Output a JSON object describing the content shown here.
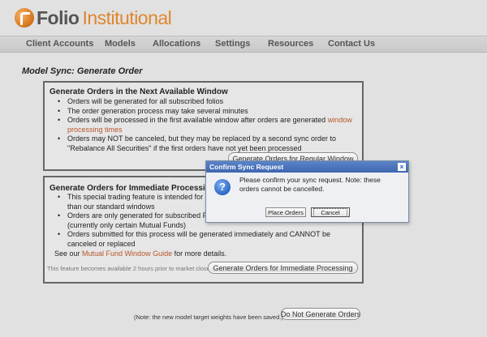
{
  "brand": {
    "name_bold": "Folio",
    "name_light": "Institutional"
  },
  "nav": {
    "items": [
      {
        "label": "Client Accounts"
      },
      {
        "label": "Models"
      },
      {
        "label": "Allocations"
      },
      {
        "label": "Settings"
      },
      {
        "label": "Resources"
      },
      {
        "label": "Contact Us"
      }
    ]
  },
  "page": {
    "title": "Model Sync: Generate Order"
  },
  "panel_regular": {
    "title": "Generate Orders in the Next Available Window",
    "bullets": [
      "Orders will be generated for all subscribed folios",
      "The order generation process may take several minutes",
      "Orders will be processed in the first available window after orders are generated",
      "Orders may NOT be canceled, but they may be replaced by a second sync order to \"Rebalance All Securities\" if the first orders have not yet been processed"
    ],
    "window_link": "window processing times",
    "button": "Generate Orders for Regular Window"
  },
  "panel_immediate": {
    "title": "Generate Orders for Immediate Processing",
    "bullets": [
      "This special trading feature is intended for mu",
      "than our standard windows",
      "Orders are only generated for subscribed Foli",
      "(currently only certain Mutual Funds)",
      "Orders submitted for this process will be generated immediately and CANNOT be canceled or replaced"
    ],
    "guide_prefix": "See our ",
    "guide_link": "Mutual Fund Window Guide",
    "guide_suffix": " for more details.",
    "availability_note": "This feature becomes available 2 hours prior to market close",
    "button": "Generate Orders for Immediate Processing"
  },
  "footer": {
    "note": "(Note: the new model target weights have been saved.)",
    "button": "Do Not Generate Orders"
  },
  "dialog": {
    "title": "Confirm Sync Request",
    "close": "×",
    "icon": "question-icon",
    "message": "Please confirm your sync request. Note: these orders cannot be cancelled.",
    "place_orders": "Place Orders",
    "cancel": "Cancel"
  },
  "colors": {
    "accent": "#e0862c",
    "link": "#b7562a",
    "dialog_title": "#3e66b0"
  }
}
